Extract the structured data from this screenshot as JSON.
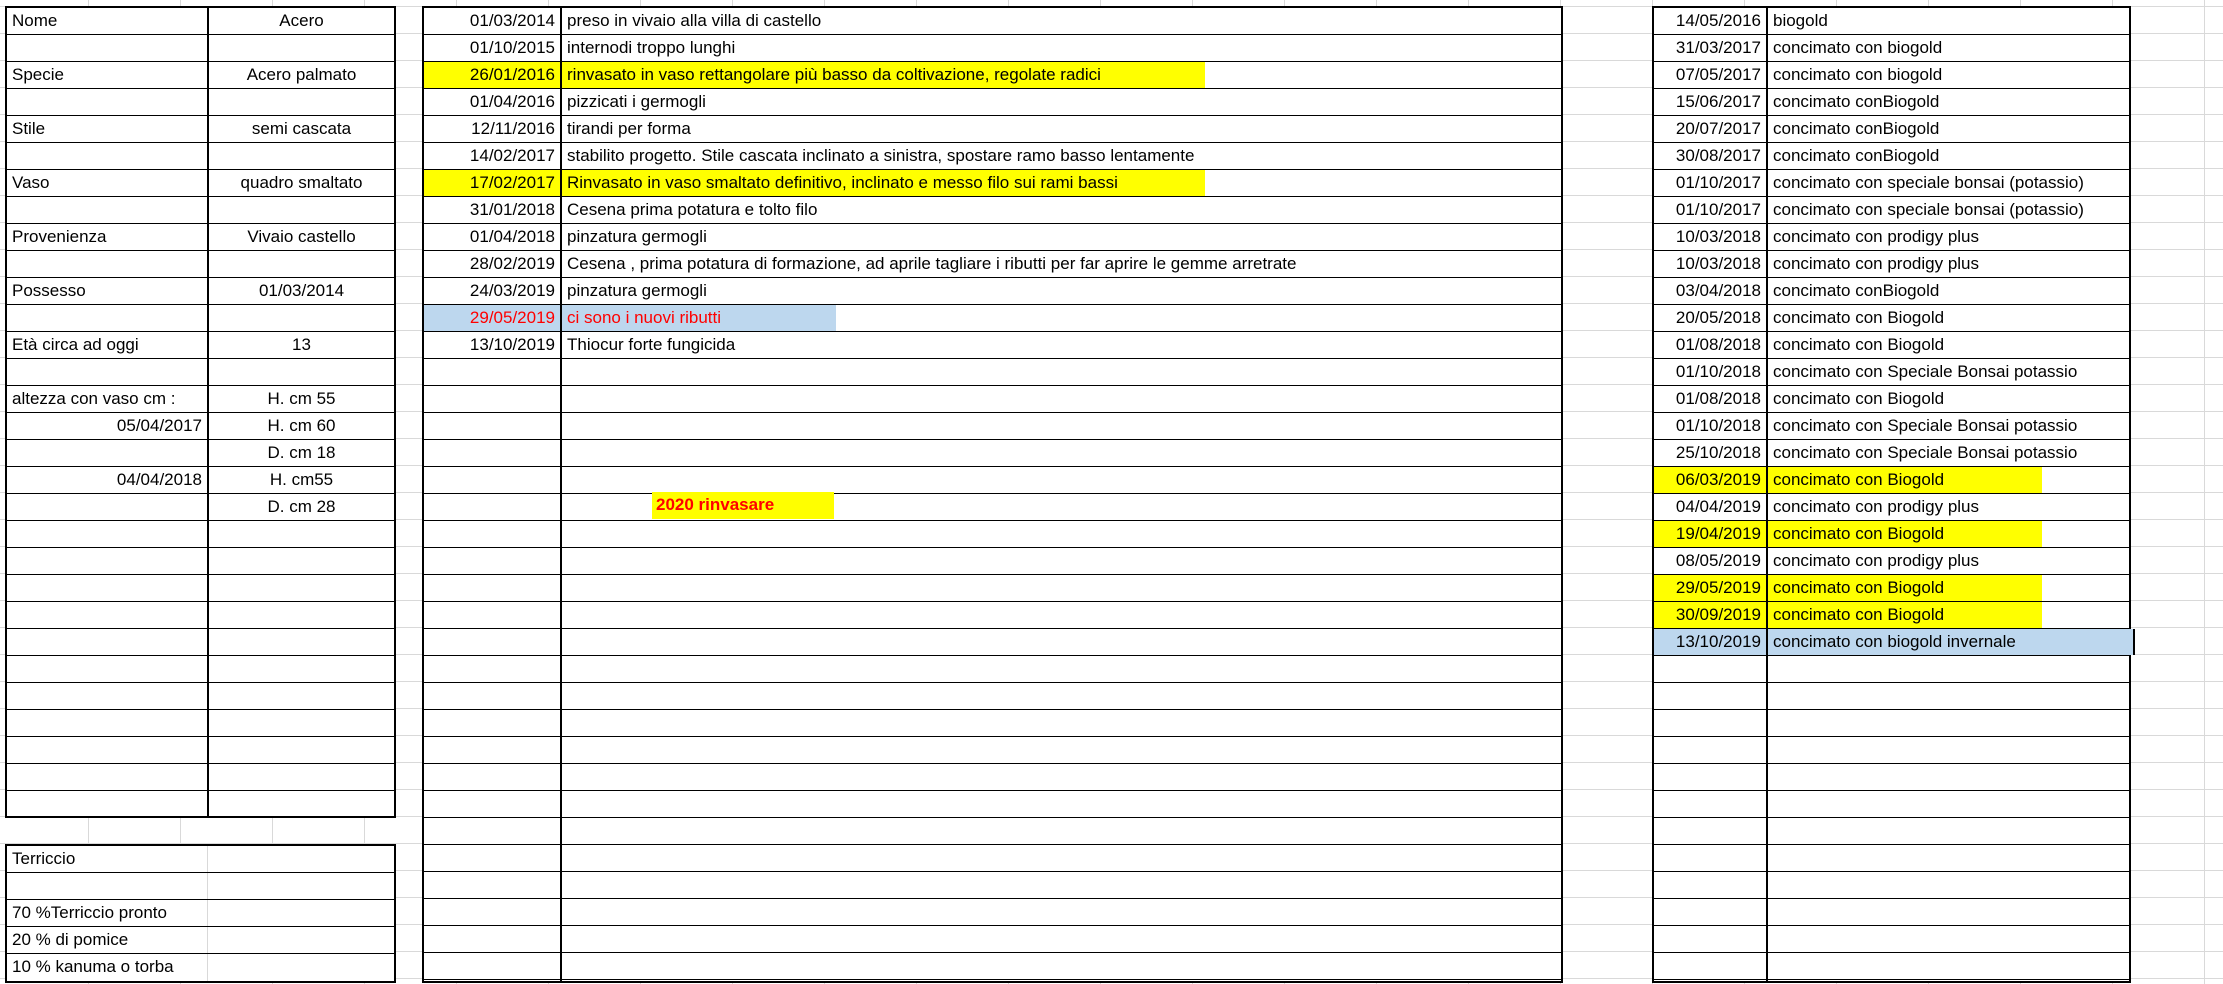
{
  "colors": {
    "highlight_yellow": "#ffff00",
    "highlight_blue": "#bdd7ee",
    "red_text": "#ff0000",
    "border": "#000000",
    "grid": "#d9d9d9"
  },
  "info": {
    "rows": [
      [
        "Nome",
        "Acero"
      ],
      [
        "",
        ""
      ],
      [
        "Specie",
        "Acero palmato"
      ],
      [
        "",
        ""
      ],
      [
        "Stile",
        "semi cascata"
      ],
      [
        "",
        ""
      ],
      [
        "Vaso",
        "quadro smaltato"
      ],
      [
        "",
        ""
      ],
      [
        "Provenienza",
        "Vivaio castello"
      ],
      [
        "",
        ""
      ],
      [
        "Possesso",
        "01/03/2014"
      ],
      [
        "",
        ""
      ],
      [
        "Età circa ad oggi",
        "13"
      ],
      [
        "",
        ""
      ],
      [
        "altezza con vaso cm :",
        "H. cm 55"
      ],
      [
        "05/04/2017",
        "H. cm 60"
      ],
      [
        "",
        "D. cm 18"
      ],
      [
        "04/04/2018",
        "H. cm55"
      ],
      [
        "",
        "D. cm 28"
      ],
      [
        "",
        ""
      ],
      [
        "",
        ""
      ],
      [
        "",
        ""
      ],
      [
        "",
        ""
      ],
      [
        "",
        ""
      ],
      [
        "",
        ""
      ],
      [
        "",
        ""
      ],
      [
        "",
        ""
      ],
      [
        "",
        ""
      ],
      [
        "",
        ""
      ],
      [
        "",
        ""
      ]
    ]
  },
  "soil": {
    "rows": [
      "Terriccio",
      "",
      "70 %Terriccio pronto",
      "20 % di pomice",
      "10 % kanuma o torba"
    ]
  },
  "log": {
    "entries": [
      {
        "date": "01/03/2014",
        "text": "preso in vivaio alla villa di castello",
        "style": ""
      },
      {
        "date": "01/10/2015",
        "text": "internodi troppo lunghi",
        "style": ""
      },
      {
        "date": "26/01/2016",
        "text": "rinvasato in vaso rettangolare più basso da coltivazione, regolate radici",
        "style": "yellow"
      },
      {
        "date": "01/04/2016",
        "text": "pizzicati i germogli",
        "style": ""
      },
      {
        "date": "12/11/2016",
        "text": "tirandi per forma",
        "style": ""
      },
      {
        "date": "14/02/2017",
        "text": "stabilito progetto. Stile cascata inclinato a sinistra, spostare ramo basso lentamente",
        "style": ""
      },
      {
        "date": "17/02/2017",
        "text": "Rinvasato in vaso smaltato definitivo, inclinato e messo filo sui rami bassi",
        "style": "yellow"
      },
      {
        "date": "31/01/2018",
        "text": "Cesena prima potatura e tolto filo",
        "style": ""
      },
      {
        "date": "01/04/2018",
        "text": "pinzatura germogli",
        "style": ""
      },
      {
        "date": "28/02/2019",
        "text": "Cesena , prima potatura di formazione, ad aprile tagliare i ributti per far aprire le gemme arretrate",
        "style": ""
      },
      {
        "date": "24/03/2019",
        "text": "pinzatura germogli",
        "style": ""
      },
      {
        "date": "29/05/2019",
        "text": "ci sono i nuovi ributti",
        "style": "blue-red"
      },
      {
        "date": "13/10/2019",
        "text": "Thiocur forte fungicida",
        "style": ""
      }
    ],
    "note": "2020 rinvasare"
  },
  "fert": {
    "entries": [
      {
        "date": "14/05/2016",
        "text": "biogold",
        "style": ""
      },
      {
        "date": "31/03/2017",
        "text": "concimato con biogold",
        "style": ""
      },
      {
        "date": "07/05/2017",
        "text": "concimato con biogold",
        "style": ""
      },
      {
        "date": "15/06/2017",
        "text": "concimato conBiogold",
        "style": ""
      },
      {
        "date": "20/07/2017",
        "text": "concimato conBiogold",
        "style": ""
      },
      {
        "date": "30/08/2017",
        "text": "concimato conBiogold",
        "style": ""
      },
      {
        "date": "01/10/2017",
        "text": "concimato con speciale bonsai (potassio)",
        "style": ""
      },
      {
        "date": "01/10/2017",
        "text": "concimato con speciale bonsai (potassio)",
        "style": ""
      },
      {
        "date": "10/03/2018",
        "text": "concimato con prodigy plus",
        "style": ""
      },
      {
        "date": "10/03/2018",
        "text": "concimato con prodigy plus",
        "style": ""
      },
      {
        "date": "03/04/2018",
        "text": "concimato conBiogold",
        "style": ""
      },
      {
        "date": "20/05/2018",
        "text": "concimato con Biogold",
        "style": ""
      },
      {
        "date": "01/08/2018",
        "text": "concimato con Biogold",
        "style": ""
      },
      {
        "date": "01/10/2018",
        "text": "concimato con Speciale Bonsai potassio",
        "style": ""
      },
      {
        "date": "01/08/2018",
        "text": "concimato con Biogold",
        "style": ""
      },
      {
        "date": "01/10/2018",
        "text": "concimato con Speciale Bonsai potassio",
        "style": ""
      },
      {
        "date": "25/10/2018",
        "text": "concimato con Speciale Bonsai potassio",
        "style": ""
      },
      {
        "date": "06/03/2019",
        "text": "concimato con Biogold",
        "style": "yellow"
      },
      {
        "date": "04/04/2019",
        "text": "concimato con prodigy plus",
        "style": ""
      },
      {
        "date": "19/04/2019",
        "text": "concimato con Biogold",
        "style": "yellow"
      },
      {
        "date": "08/05/2019",
        "text": "concimato con prodigy plus",
        "style": ""
      },
      {
        "date": "29/05/2019",
        "text": "concimato con Biogold",
        "style": "yellow"
      },
      {
        "date": "30/09/2019",
        "text": "concimato con Biogold",
        "style": "yellow"
      },
      {
        "date": "13/10/2019",
        "text": "concimato con biogold invernale",
        "style": "blue"
      }
    ]
  }
}
